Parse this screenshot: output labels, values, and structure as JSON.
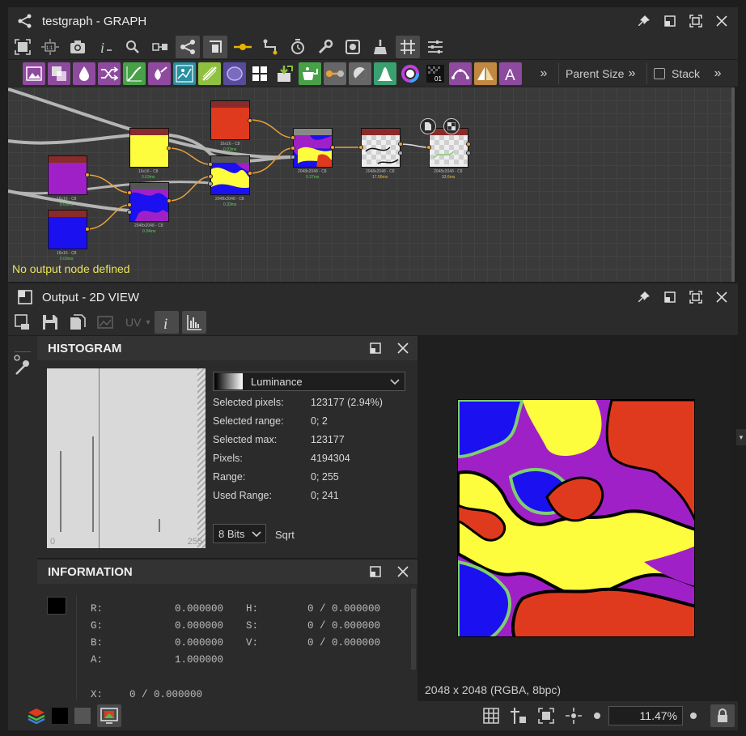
{
  "graph_panel": {
    "title": "testgraph - GRAPH",
    "parent_size_label": "Parent Size",
    "stack_label": "Stack",
    "status_message": "No output node defined",
    "nodes": [
      {
        "label": "16x16 - C8",
        "time": "0.03ms"
      },
      {
        "label": "16x16 - C8",
        "time": "0.03ms"
      },
      {
        "label": "16x16 - C8",
        "time": "0.03ms"
      },
      {
        "label": "16x16 - C8",
        "time": "0.03ms"
      },
      {
        "label": "2048x2048 - C8",
        "time": "0.34ms"
      },
      {
        "label": "2048x2048 - C8",
        "time": "0.33ms"
      },
      {
        "label": "2048x2048 - C8",
        "time": "0.37ms"
      },
      {
        "label": "2048x2048 - C8",
        "time": "17.56ms"
      },
      {
        "label": "2048x2048 - C8",
        "time": "33.6ms"
      }
    ]
  },
  "output_panel": {
    "title": "Output - 2D VIEW",
    "uv_label": "UV"
  },
  "histogram": {
    "title": "HISTOGRAM",
    "axis_min": "0",
    "axis_max": "255",
    "channel": "Luminance",
    "stats": [
      {
        "label": "Selected pixels:",
        "value": "123177 (2.94%)"
      },
      {
        "label": "Selected range:",
        "value": "0; 2"
      },
      {
        "label": "Selected max:",
        "value": "123177"
      },
      {
        "label": "Pixels:",
        "value": "4194304"
      },
      {
        "label": "Range:",
        "value": "0; 255"
      },
      {
        "label": "Used Range:",
        "value": "0; 241"
      }
    ],
    "bits": "8 Bits",
    "sqrt_label": "Sqrt",
    "bar_levels": [
      0.5,
      0.59,
      0.08
    ]
  },
  "information": {
    "title": "INFORMATION",
    "swatch_color": "#000000",
    "rows": [
      {
        "k1": "R:",
        "v1": "0.000000",
        "k2": "H:",
        "v2": "0 / 0.000000"
      },
      {
        "k1": "G:",
        "v1": "0.000000",
        "k2": "S:",
        "v2": "0 / 0.000000"
      },
      {
        "k1": "B:",
        "v1": "0.000000",
        "k2": "V:",
        "v2": "0 / 0.000000"
      },
      {
        "k1": "A:",
        "v1": "1.000000",
        "k2": "",
        "v2": ""
      }
    ],
    "x_label": "X:",
    "x_value": "0 / 0.000000"
  },
  "view": {
    "image_info": "2048 x 2048 (RGBA, 8bpc)",
    "zoom": "11.47%"
  },
  "colors": {
    "node_header": "#8a2b2b",
    "port": "#e8a23a",
    "status_text": "#e8e35a",
    "texture_red": "#e03a1e",
    "texture_yellow": "#fdfd3e",
    "texture_purple": "#a02fd0",
    "texture_blue": "#1a10f0",
    "texture_outline": "#7fcf6f"
  }
}
